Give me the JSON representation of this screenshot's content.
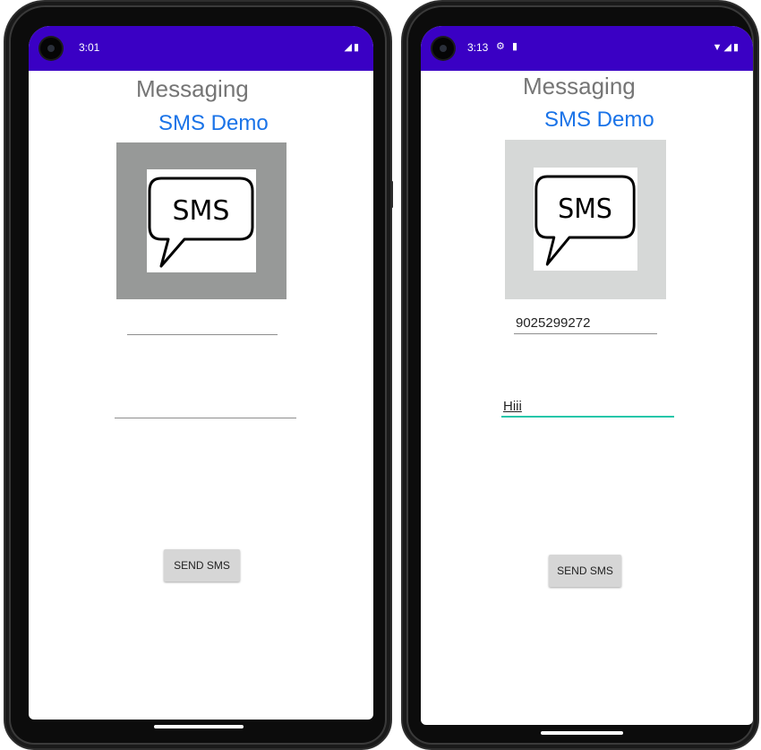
{
  "left": {
    "status": {
      "time": "3:01",
      "icons": "◢▮"
    },
    "title": "Messaging",
    "subtitle": "SMS Demo",
    "sms_icon_text": "SMS",
    "phone_field": {
      "value": ""
    },
    "message_field": {
      "value": ""
    },
    "send_button": "SEND SMS"
  },
  "right": {
    "status": {
      "time": "3:13",
      "icons": "▼◢▮",
      "extra_icons": [
        "settings-icon",
        "sd-card-icon"
      ]
    },
    "title": "Messaging",
    "subtitle": "SMS Demo",
    "sms_icon_text": "SMS",
    "phone_field": {
      "value": "9025299272"
    },
    "message_field": {
      "value": "Hiii"
    },
    "send_button": "SEND SMS"
  },
  "colors": {
    "status_bar": "#3a00c4",
    "subtitle": "#1a73e8",
    "focus_underline": "#26c6a9",
    "image_bg_left": "#979998",
    "image_bg_right": "#d6d8d7"
  }
}
